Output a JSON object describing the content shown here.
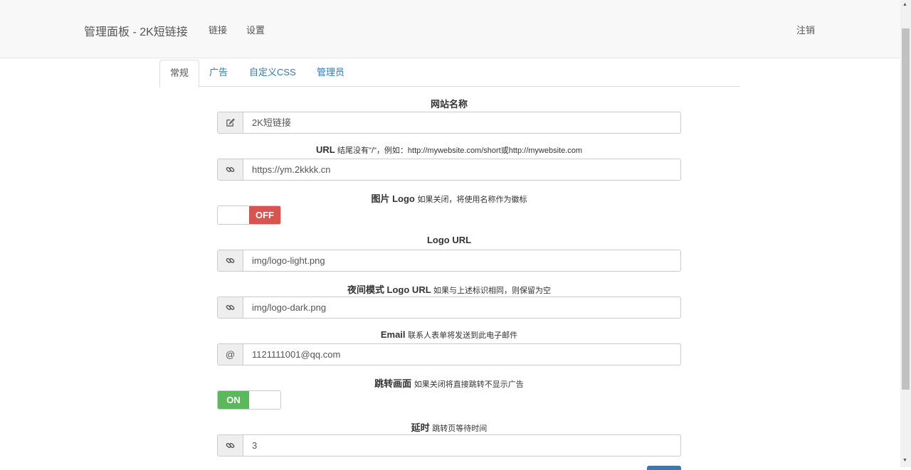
{
  "nav": {
    "brand": "管理面板 - 2K短链接",
    "links": [
      "链接",
      "设置"
    ],
    "logout": "注销"
  },
  "tabs": [
    "常规",
    "广告",
    "自定义CSS",
    "管理员"
  ],
  "form": {
    "site_name": {
      "label": "网站名称",
      "value": "2K短链接",
      "icon": "edit-icon"
    },
    "url": {
      "label": "URL",
      "hint": "结尾没有\"/\"，例如：http://mywebsite.com/short或http://mywebsite.com",
      "value": "https://ym.2kkkk.cn",
      "icon": "link-icon"
    },
    "image_logo": {
      "label": "图片 Logo",
      "hint": "如果关闭，将使用名称作为徽标",
      "state": "OFF",
      "color": "#d9534f"
    },
    "logo_url": {
      "label": "Logo URL",
      "value": "img/logo-light.png",
      "icon": "link-icon"
    },
    "dark_logo_url": {
      "label": "夜间模式 Logo URL",
      "hint": "如果与上述标识相同，则保留为空",
      "value": "img/logo-dark.png",
      "icon": "link-icon"
    },
    "email": {
      "label": "Email",
      "hint": "联系人表单将发送到此电子邮件",
      "value": "1121111001@qq.com",
      "icon_text": "@"
    },
    "redirect_page": {
      "label": "跳转画面",
      "hint": "如果关闭将直接跳转不显示广告",
      "state": "ON",
      "color": "#5cb85c"
    },
    "delay": {
      "label": "延时",
      "hint": "跳转页等待时间",
      "value": "3",
      "icon": "link-icon"
    }
  },
  "colors": {
    "link": "#337ab7",
    "navbar_bg": "#f8f8f8"
  }
}
